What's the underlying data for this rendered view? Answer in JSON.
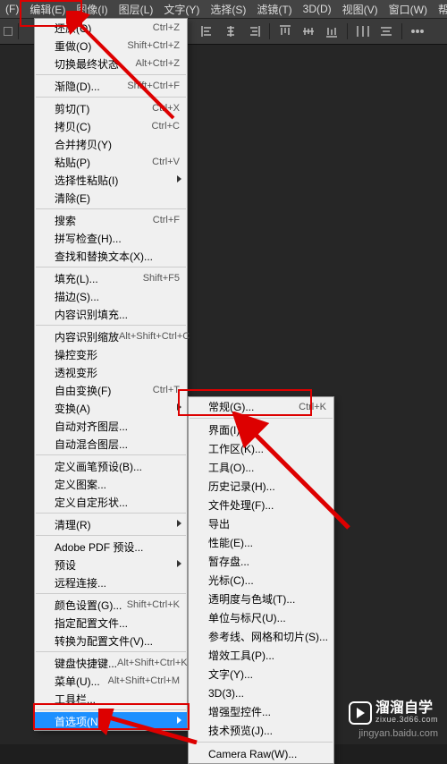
{
  "menubar": {
    "items": [
      "(F)",
      "编辑(E)",
      "图像(I)",
      "图层(L)",
      "文字(Y)",
      "选择(S)",
      "滤镜(T)",
      "3D(D)",
      "视图(V)",
      "窗口(W)",
      "帮助(H)"
    ]
  },
  "edit_menu": {
    "groups": [
      [
        {
          "label": "还原(O)",
          "shortcut": "Ctrl+Z",
          "arrow": false
        },
        {
          "label": "重做(O)",
          "shortcut": "Shift+Ctrl+Z",
          "arrow": false
        },
        {
          "label": "切换最终状态",
          "shortcut": "Alt+Ctrl+Z",
          "arrow": false
        }
      ],
      [
        {
          "label": "渐隐(D)...",
          "shortcut": "Shift+Ctrl+F",
          "arrow": false
        }
      ],
      [
        {
          "label": "剪切(T)",
          "shortcut": "Ctrl+X",
          "arrow": false
        },
        {
          "label": "拷贝(C)",
          "shortcut": "Ctrl+C",
          "arrow": false
        },
        {
          "label": "合并拷贝(Y)",
          "shortcut": "",
          "arrow": false
        },
        {
          "label": "粘贴(P)",
          "shortcut": "Ctrl+V",
          "arrow": false
        },
        {
          "label": "选择性粘贴(I)",
          "shortcut": "",
          "arrow": true
        },
        {
          "label": "清除(E)",
          "shortcut": "",
          "arrow": false
        }
      ],
      [
        {
          "label": "搜索",
          "shortcut": "Ctrl+F",
          "arrow": false
        },
        {
          "label": "拼写检查(H)...",
          "shortcut": "",
          "arrow": false
        },
        {
          "label": "查找和替换文本(X)...",
          "shortcut": "",
          "arrow": false
        }
      ],
      [
        {
          "label": "填充(L)...",
          "shortcut": "Shift+F5",
          "arrow": false
        },
        {
          "label": "描边(S)...",
          "shortcut": "",
          "arrow": false
        },
        {
          "label": "内容识别填充...",
          "shortcut": "",
          "arrow": false
        }
      ],
      [
        {
          "label": "内容识别缩放",
          "shortcut": "Alt+Shift+Ctrl+C",
          "arrow": false
        },
        {
          "label": "操控变形",
          "shortcut": "",
          "arrow": false
        },
        {
          "label": "透视变形",
          "shortcut": "",
          "arrow": false
        },
        {
          "label": "自由变换(F)",
          "shortcut": "Ctrl+T",
          "arrow": false
        },
        {
          "label": "变换(A)",
          "shortcut": "",
          "arrow": true
        },
        {
          "label": "自动对齐图层...",
          "shortcut": "",
          "arrow": false
        },
        {
          "label": "自动混合图层...",
          "shortcut": "",
          "arrow": false
        }
      ],
      [
        {
          "label": "定义画笔预设(B)...",
          "shortcut": "",
          "arrow": false
        },
        {
          "label": "定义图案...",
          "shortcut": "",
          "arrow": false
        },
        {
          "label": "定义自定形状...",
          "shortcut": "",
          "arrow": false
        }
      ],
      [
        {
          "label": "清理(R)",
          "shortcut": "",
          "arrow": true
        }
      ],
      [
        {
          "label": "Adobe PDF 预设...",
          "shortcut": "",
          "arrow": false
        },
        {
          "label": "预设",
          "shortcut": "",
          "arrow": true
        },
        {
          "label": "远程连接...",
          "shortcut": "",
          "arrow": false
        }
      ],
      [
        {
          "label": "颜色设置(G)...",
          "shortcut": "Shift+Ctrl+K",
          "arrow": false
        },
        {
          "label": "指定配置文件...",
          "shortcut": "",
          "arrow": false
        },
        {
          "label": "转换为配置文件(V)...",
          "shortcut": "",
          "arrow": false
        }
      ],
      [
        {
          "label": "键盘快捷键...",
          "shortcut": "Alt+Shift+Ctrl+K",
          "arrow": false
        },
        {
          "label": "菜单(U)...",
          "shortcut": "Alt+Shift+Ctrl+M",
          "arrow": false
        },
        {
          "label": "工具栏...",
          "shortcut": "",
          "arrow": false
        }
      ],
      [
        {
          "label": "首选项(N)",
          "shortcut": "",
          "arrow": true,
          "highlight": true
        }
      ]
    ]
  },
  "preferences_submenu": {
    "groups": [
      [
        {
          "label": "常规(G)...",
          "shortcut": "Ctrl+K"
        }
      ],
      [
        {
          "label": "界面(I)..."
        },
        {
          "label": "工作区(K)..."
        },
        {
          "label": "工具(O)..."
        },
        {
          "label": "历史记录(H)..."
        },
        {
          "label": "文件处理(F)..."
        },
        {
          "label": "导出"
        },
        {
          "label": "性能(E)..."
        },
        {
          "label": "暂存盘..."
        },
        {
          "label": "光标(C)..."
        },
        {
          "label": "透明度与色域(T)..."
        },
        {
          "label": "单位与标尺(U)..."
        },
        {
          "label": "参考线、网格和切片(S)..."
        },
        {
          "label": "增效工具(P)..."
        },
        {
          "label": "文字(Y)..."
        },
        {
          "label": "3D(3)..."
        },
        {
          "label": "增强型控件..."
        },
        {
          "label": "技术预览(J)..."
        }
      ],
      [
        {
          "label": "Camera Raw(W)..."
        }
      ]
    ]
  },
  "watermark": {
    "brand": "溜溜自学",
    "sub": "zixue.3d66.com",
    "credit": "jingyan.baidu.com"
  }
}
